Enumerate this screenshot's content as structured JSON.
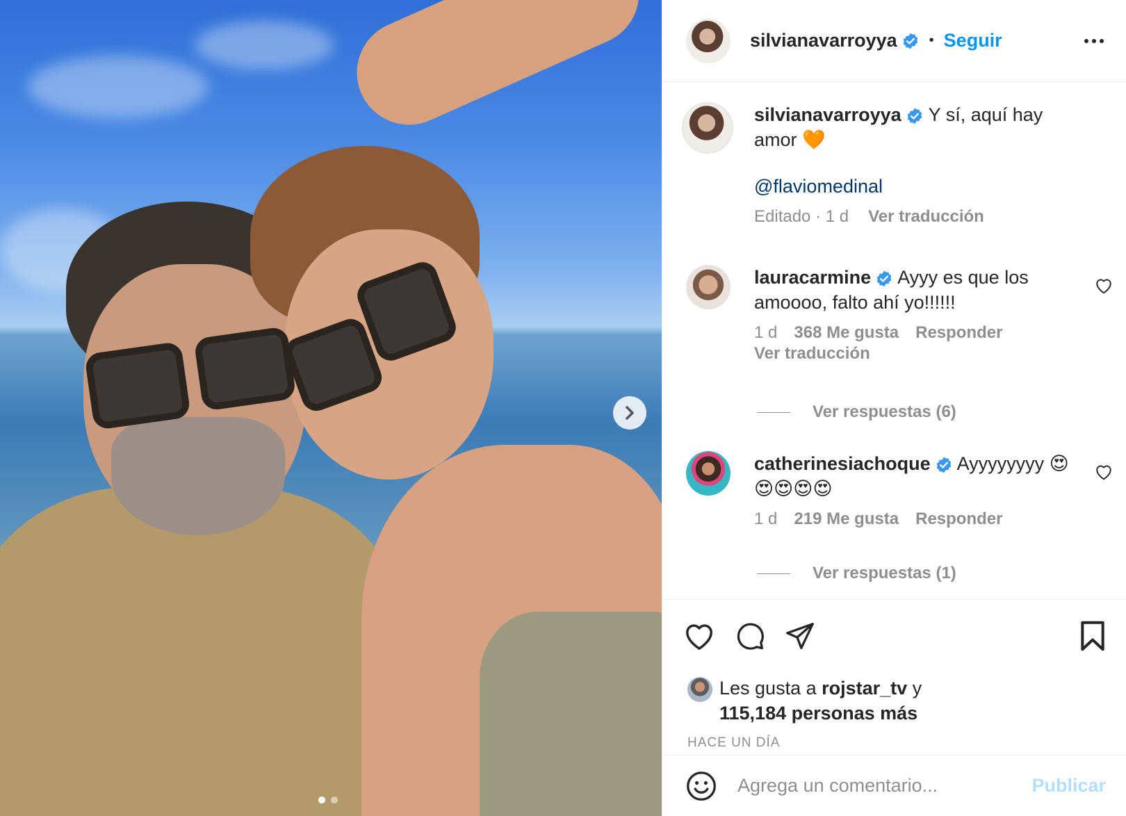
{
  "post": {
    "author": "silvianavarroyya",
    "follow_label": "Seguir",
    "separator": "•",
    "caption_text": "Y sí, aquí hay amor 🧡",
    "caption_mention": "@flaviomedinal",
    "caption_meta_time": "Editado · 1 d",
    "caption_translate": "Ver traducción"
  },
  "comments": [
    {
      "user": "lauracarmine",
      "text": "Ayyy es que los amoooo, falto ahí yo!!!!!!",
      "time": "1 d",
      "likes": "368 Me gusta",
      "reply_label": "Responder",
      "translate": "Ver traducción",
      "view_replies": "Ver respuestas (6)"
    },
    {
      "user": "catherinesiachoque",
      "text": "Ayyyyyyyy 😍😍😍😍😍",
      "time": "1 d",
      "likes": "219 Me gusta",
      "reply_label": "Responder",
      "view_replies": "Ver respuestas (1)"
    }
  ],
  "likes": {
    "prefix": "Les gusta a ",
    "user": "rojstar_tv",
    "mid": " y",
    "count": "115,184 personas más"
  },
  "timestamp": "HACE UN DÍA",
  "add_comment": {
    "placeholder": "Agrega un comentario...",
    "publish_label": "Publicar"
  },
  "carousel": {
    "current": 1,
    "total": 2
  },
  "colors": {
    "link": "#0095f6",
    "mention": "#00376b",
    "verified": "#3897f0",
    "muted": "#8e8e8e"
  },
  "icons": [
    "heart-icon",
    "comment-icon",
    "share-icon",
    "bookmark-icon",
    "emoji-icon",
    "more-icon",
    "verified-icon",
    "chevron-right-icon"
  ]
}
